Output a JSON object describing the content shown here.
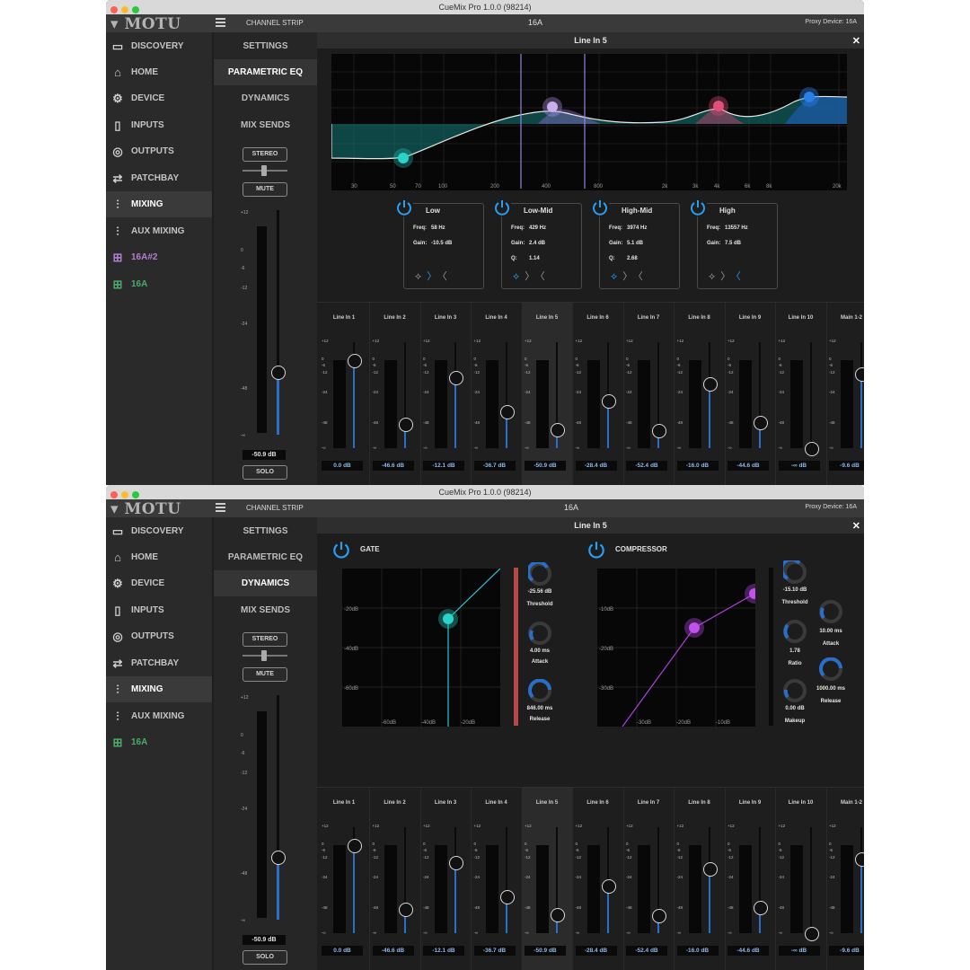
{
  "app_title": "CueMix Pro 1.0.0 (98214)",
  "logo": "MOTU",
  "channel_strip_label": "CHANNEL STRIP",
  "device_title": "16A",
  "proxy_device": "Proxy Device: 16A",
  "close_label": "✕",
  "sidebar": {
    "items_top": [
      {
        "label": "DISCOVERY",
        "icon": "discovery-icon"
      },
      {
        "label": "HOME",
        "icon": "home-icon"
      },
      {
        "label": "DEVICE",
        "icon": "device-gear-icon"
      },
      {
        "label": "INPUTS",
        "icon": "inputs-icon"
      },
      {
        "label": "OUTPUTS",
        "icon": "outputs-icon"
      },
      {
        "label": "PATCHBAY",
        "icon": "patchbay-icon"
      },
      {
        "label": "MIXING",
        "icon": "mixing-icon"
      },
      {
        "label": "AUX MIXING",
        "icon": "aux-mixing-icon"
      },
      {
        "label": "16A#2",
        "icon": "network-device-icon"
      },
      {
        "label": "16A",
        "icon": "network-device-icon"
      }
    ],
    "items_bottom": [
      {
        "label": "DISCOVERY"
      },
      {
        "label": "HOME"
      },
      {
        "label": "DEVICE"
      },
      {
        "label": "INPUTS"
      },
      {
        "label": "OUTPUTS"
      },
      {
        "label": "PATCHBAY"
      },
      {
        "label": "MIXING"
      },
      {
        "label": "AUX MIXING"
      },
      {
        "label": "16A"
      }
    ]
  },
  "channel_strip": {
    "tabs": [
      "SETTINGS",
      "PARAMETRIC EQ",
      "DYNAMICS",
      "MIX SENDS"
    ],
    "stereo": "STEREO",
    "mute": "MUTE",
    "solo": "SOLO",
    "fader_value": "-50.9 dB",
    "scale": [
      "+12",
      "0",
      "-6",
      "-12",
      "-24",
      "-48",
      "-∞"
    ],
    "fader_level": 0.28
  },
  "panel_title": "Line In 5",
  "eq": {
    "freq_ticks": [
      "30",
      "50",
      "70",
      "100",
      "200",
      "400",
      "800",
      "2k",
      "3k",
      "4k",
      "6k",
      "8k",
      "20k"
    ],
    "bands": [
      {
        "name": "Low",
        "freq_label": "Freq:",
        "freq": "58 Hz",
        "gain_label": "Gain:",
        "gain": "-10.5 dB",
        "color": "#2ad4c8"
      },
      {
        "name": "Low-Mid",
        "freq_label": "Freq:",
        "freq": "429 Hz",
        "gain_label": "Gain:",
        "gain": "2.4 dB",
        "q_label": "Q:",
        "q": "1.14",
        "color": "#b79ce8"
      },
      {
        "name": "High-Mid",
        "freq_label": "Freq:",
        "freq": "3974 Hz",
        "gain_label": "Gain:",
        "gain": "5.1 dB",
        "q_label": "Q:",
        "q": "2.68",
        "color": "#e0507a"
      },
      {
        "name": "High",
        "freq_label": "Freq:",
        "freq": "13557 Hz",
        "gain_label": "Gain:",
        "gain": "7.5 dB",
        "color": "#2a7ee8"
      }
    ]
  },
  "dynamics": {
    "gate_title": "GATE",
    "compressor_title": "COMPRESSOR",
    "gate_y_ticks": [
      "-20dB",
      "-40dB",
      "-60dB"
    ],
    "gate_x_ticks": [
      "-60dB",
      "-40dB",
      "-20dB"
    ],
    "comp_y_ticks": [
      "-10dB",
      "-20dB",
      "-30dB"
    ],
    "comp_x_ticks": [
      "-30dB",
      "-20dB",
      "-10dB"
    ],
    "gate_threshold": "-25.56 dB",
    "gate_threshold_label": "Threshold",
    "gate_attack": "4.00 ms",
    "gate_attack_label": "Attack",
    "gate_release": "846.00 ms",
    "gate_release_label": "Release",
    "comp_threshold": "-15.10 dB",
    "comp_threshold_label": "Threshold",
    "comp_ratio": "1.78",
    "comp_ratio_label": "Ratio",
    "comp_makeup": "0.00 dB",
    "comp_makeup_label": "Makeup",
    "comp_attack": "10.00 ms",
    "comp_attack_label": "Attack",
    "comp_release": "1000.00 ms",
    "comp_release_label": "Release"
  },
  "mixer": {
    "scale": [
      "+12",
      "0",
      "-6",
      "-12",
      "-24",
      "-48",
      "-∞"
    ],
    "strips": [
      {
        "name": "Line In 1",
        "value": "0.0 dB",
        "level": 0.83
      },
      {
        "name": "Line In 2",
        "value": "-46.6 dB",
        "level": 0.23
      },
      {
        "name": "Line In 3",
        "value": "-12.1 dB",
        "level": 0.67
      },
      {
        "name": "Line In 4",
        "value": "-36.7 dB",
        "level": 0.35
      },
      {
        "name": "Line In 5",
        "value": "-50.9 dB",
        "level": 0.18
      },
      {
        "name": "Line In 6",
        "value": "-28.4 dB",
        "level": 0.45
      },
      {
        "name": "Line In 7",
        "value": "-52.4 dB",
        "level": 0.17
      },
      {
        "name": "Line In 8",
        "value": "-16.0 dB",
        "level": 0.61
      },
      {
        "name": "Line In 9",
        "value": "-44.6 dB",
        "level": 0.25
      },
      {
        "name": "Line In 10",
        "value": "-∞ dB",
        "level": 0.0
      },
      {
        "name": "Main 1-2",
        "value": "-9.6 dB",
        "level": 0.7
      }
    ]
  }
}
